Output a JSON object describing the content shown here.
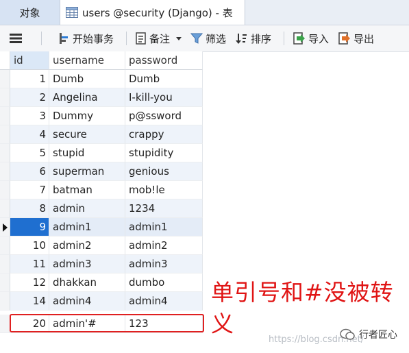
{
  "tabs": {
    "objects_label": "对象",
    "table_tab_label": "users @security (Django) - 表"
  },
  "toolbar": {
    "begin_transaction": "开始事务",
    "note": "备注",
    "filter": "筛选",
    "sort": "排序",
    "import": "导入",
    "export": "导出"
  },
  "table": {
    "columns": [
      "id",
      "username",
      "password"
    ],
    "rows": [
      {
        "id": "1",
        "username": "Dumb",
        "password": "Dumb"
      },
      {
        "id": "2",
        "username": "Angelina",
        "password": "I-kill-you"
      },
      {
        "id": "3",
        "username": "Dummy",
        "password": "p@ssword"
      },
      {
        "id": "4",
        "username": "secure",
        "password": "crappy"
      },
      {
        "id": "5",
        "username": "stupid",
        "password": "stupidity"
      },
      {
        "id": "6",
        "username": "superman",
        "password": "genious"
      },
      {
        "id": "7",
        "username": "batman",
        "password": "mob!le"
      },
      {
        "id": "8",
        "username": "admin",
        "password": "1234"
      },
      {
        "id": "9",
        "username": "admin1",
        "password": "admin1"
      },
      {
        "id": "10",
        "username": "admin2",
        "password": "admin2"
      },
      {
        "id": "11",
        "username": "admin3",
        "password": "admin3"
      },
      {
        "id": "12",
        "username": "dhakkan",
        "password": "dumbo"
      },
      {
        "id": "14",
        "username": "admin4",
        "password": "admin4"
      },
      {
        "id": "20",
        "username": "admin'#",
        "password": "123"
      }
    ],
    "selected_row_index": 8,
    "highlighted_row_index": 13
  },
  "annotation": {
    "text": "单引号和#没被转义"
  },
  "watermark": {
    "url": "https://blog.csdn.net/",
    "brand": "行者匠心"
  },
  "colors": {
    "accent": "#1f6fd0",
    "annotation": "#e01414",
    "alt_row": "#eef3fa"
  }
}
